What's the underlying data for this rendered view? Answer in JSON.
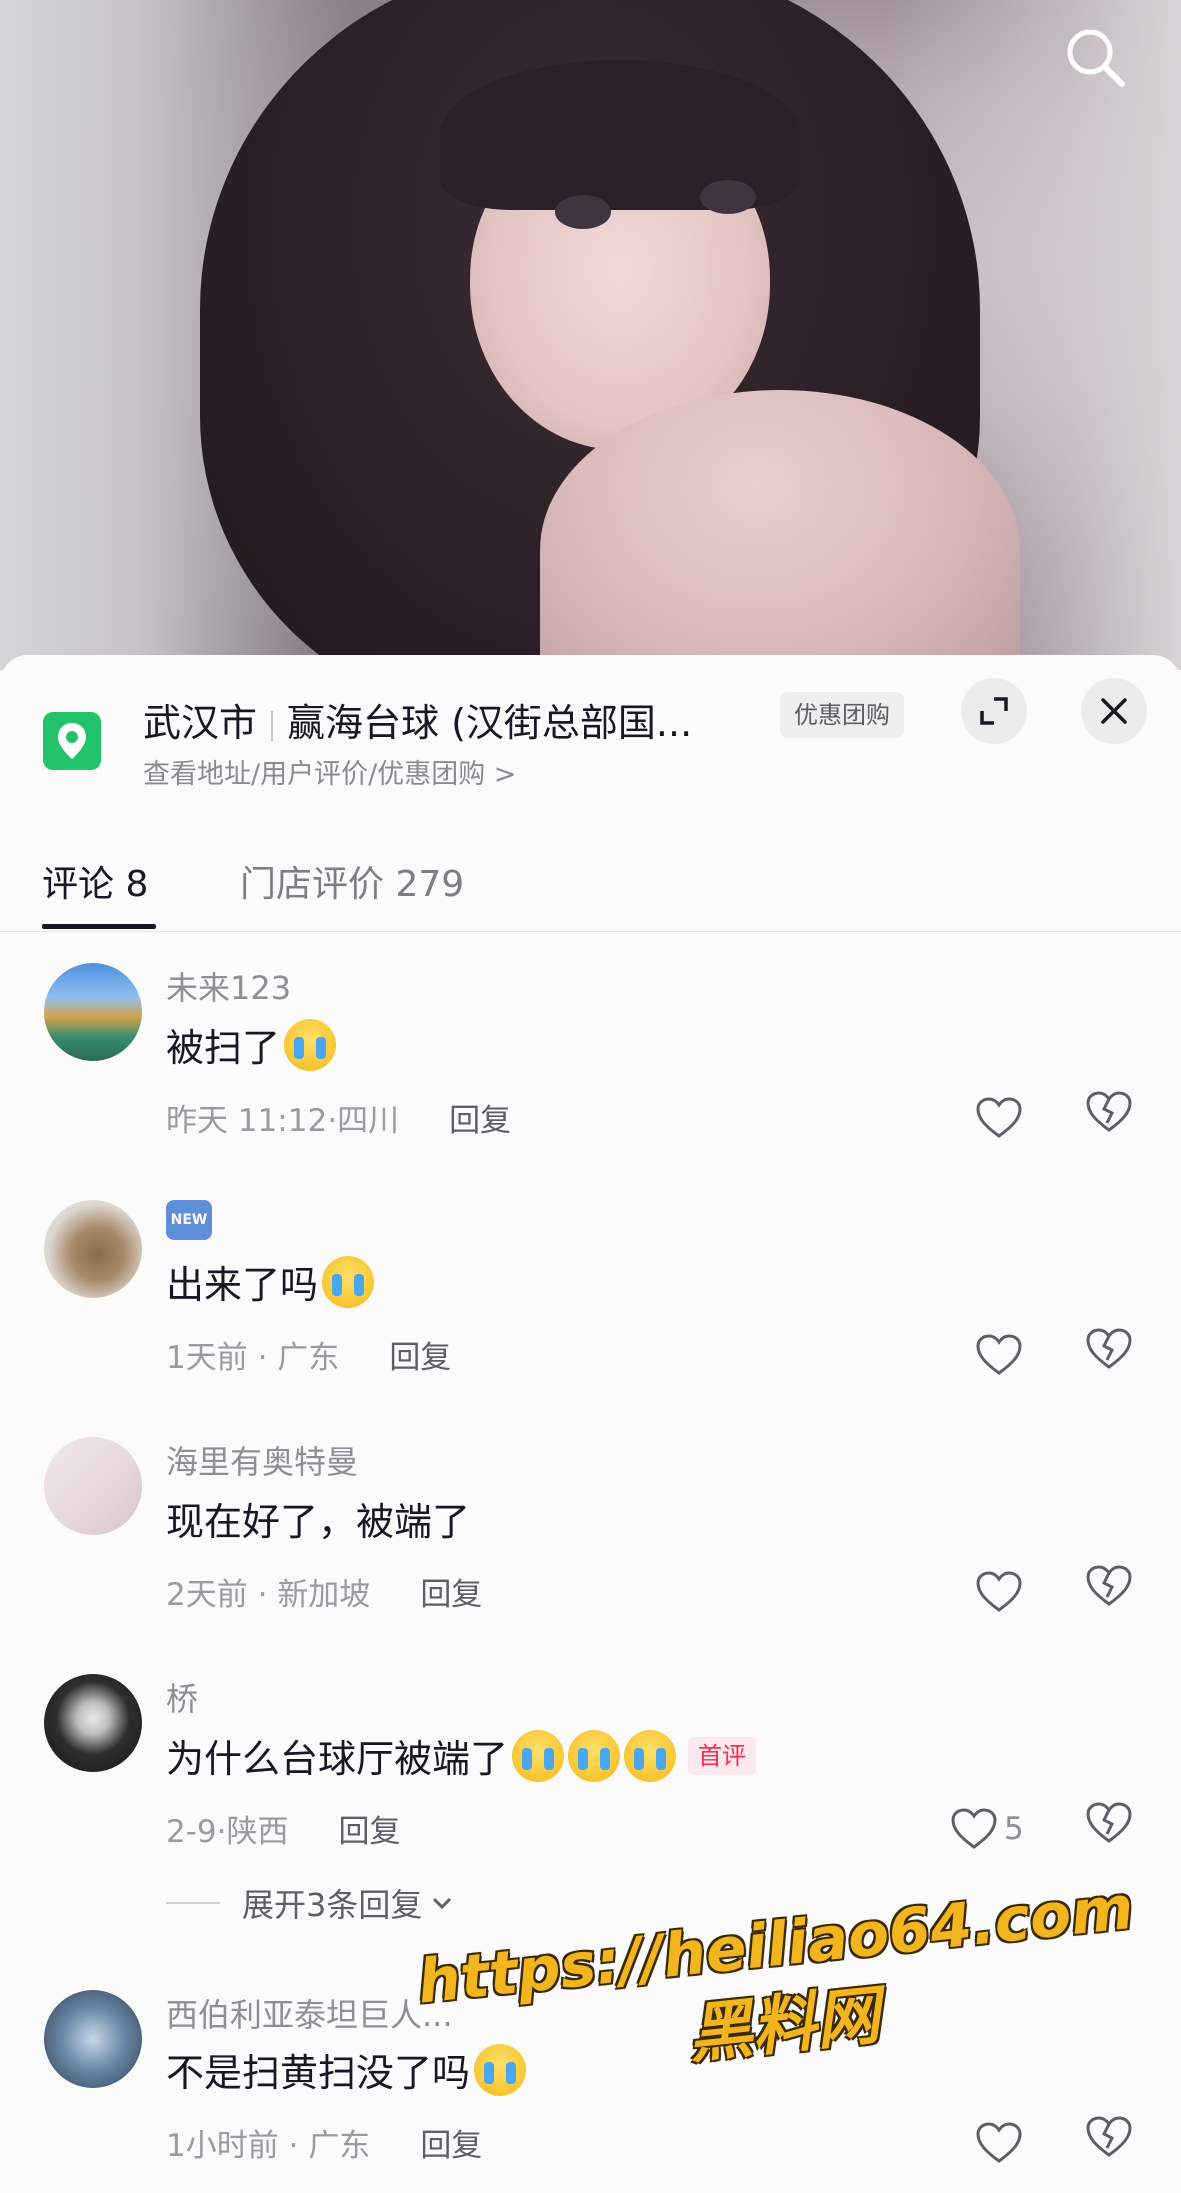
{
  "poi": {
    "city": "武汉市",
    "store_name": "赢海台球 (汉街总部国...",
    "badge": "优惠团购",
    "subtitle": "查看地址/用户评价/优惠团购 >"
  },
  "tabs": [
    {
      "label": "评论 8",
      "active": true
    },
    {
      "label": "门店评价 279",
      "active": false
    }
  ],
  "comments": [
    {
      "username": "未来123",
      "text": "被扫了",
      "emoji_count": 1,
      "time": "昨天 11:12",
      "location": "四川",
      "reply": "回复",
      "likes": ""
    },
    {
      "username": "",
      "new_badge": "NEW",
      "text": "出来了吗",
      "emoji_count": 1,
      "time": "1天前",
      "location": "广东",
      "reply": "回复",
      "likes": ""
    },
    {
      "username": "海里有奥特曼",
      "text": "现在好了，被端了",
      "emoji_count": 0,
      "time": "2天前",
      "location": "新加坡",
      "reply": "回复",
      "likes": ""
    },
    {
      "username": "桥",
      "text": "为什么台球厅被端了",
      "emoji_count": 3,
      "badge": "首评",
      "time": "2-9",
      "location": "陕西",
      "reply": "回复",
      "likes": "5"
    },
    {
      "username": "西伯利亚泰坦巨人...",
      "text": "不是扫黄扫没了吗",
      "emoji_count": 1,
      "time": "1小时前",
      "location": "广东",
      "reply": "回复",
      "likes": ""
    }
  ],
  "expand_replies": "展开3条回复",
  "watermark": {
    "url": "https://heiliao64.com",
    "name": "黑料网"
  },
  "meta_sep": "·",
  "colors": {
    "pin_green": "#23c36b",
    "accent_red": "#fe2c55",
    "watermark_yellow": "#f3b51e"
  },
  "icons": [
    "search-icon",
    "location-pin-icon",
    "expand-icon",
    "close-icon",
    "heart-icon",
    "broken-heart-icon",
    "chevron-down-icon",
    "crying-emoji-icon"
  ]
}
